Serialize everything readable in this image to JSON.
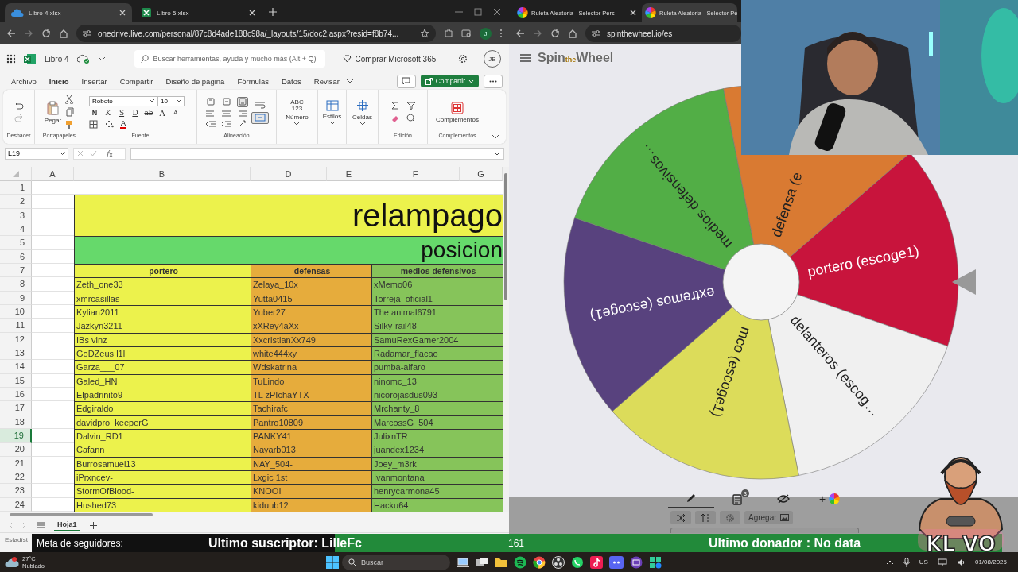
{
  "left_browser": {
    "tabs": [
      {
        "title": "Libro 4.xlsx",
        "kind": "onedrive",
        "selected": true
      },
      {
        "title": "Libro 5.xlsx",
        "kind": "excel",
        "selected": false
      }
    ],
    "url": "onedrive.live.com/personal/87c8d4ade188c98a/_layouts/15/doc2.aspx?resid=f8b74...",
    "profile": "J"
  },
  "excel": {
    "file": "Libro 4",
    "search": {
      "placeholder": "Buscar herramientas, ayuda y mucho más (Alt + Q)"
    },
    "buy": "Comprar Microsoft 365",
    "avatar": "JB",
    "menu": [
      {
        "label": "Archivo",
        "selected": false
      },
      {
        "label": "Inicio",
        "selected": true
      },
      {
        "label": "Insertar",
        "selected": false
      },
      {
        "label": "Compartir",
        "selected": false
      },
      {
        "label": "Diseño de página",
        "selected": false
      },
      {
        "label": "Fórmulas",
        "selected": false
      },
      {
        "label": "Datos",
        "selected": false
      },
      {
        "label": "Revisar",
        "selected": false
      }
    ],
    "share": "Compartir",
    "ribbon": {
      "undo_group": "Deshacer",
      "paste": "Pegar",
      "clipboard_group": "Portapapeles",
      "font": "Roboto",
      "size": "10",
      "font_buttons": [
        {
          "text": "N",
          "kind": "bold"
        },
        {
          "text": "K",
          "kind": "italic"
        },
        {
          "text": "S",
          "kind": "underline"
        },
        {
          "text": "D",
          "kind": "double"
        },
        {
          "text": "ab",
          "kind": "strike"
        },
        {
          "text": "A",
          "kind": "grow"
        },
        {
          "text": "A",
          "kind": "shrink"
        }
      ],
      "font_color_letter": "A",
      "font_group": "Fuente",
      "vertical_align": [
        {
          "selected": false
        },
        {
          "selected": false
        },
        {
          "selected": true
        }
      ],
      "merge_selected": true,
      "align_group": "Alineación",
      "number_glyph": [
        "ABC",
        "123"
      ],
      "number": "Número",
      "styles": "Estilos",
      "cells": "Celdas",
      "edit_group": "Edición",
      "addins": "Complementos",
      "addins_group": "Complementos"
    },
    "name_box": "L19",
    "sheet": {
      "columns": [
        "A",
        "B",
        "D",
        "E",
        "F",
        "G"
      ],
      "rows": [
        {
          "label": "1",
          "selected": false
        },
        {
          "label": "2",
          "selected": false
        },
        {
          "label": "3",
          "selected": false
        },
        {
          "label": "4",
          "selected": false
        },
        {
          "label": "5",
          "selected": false
        },
        {
          "label": "6",
          "selected": false
        },
        {
          "label": "7",
          "selected": false
        },
        {
          "label": "8",
          "selected": false
        },
        {
          "label": "9",
          "selected": false
        },
        {
          "label": "10",
          "selected": false
        },
        {
          "label": "11",
          "selected": false
        },
        {
          "label": "12",
          "selected": false
        },
        {
          "label": "13",
          "selected": false
        },
        {
          "label": "14",
          "selected": false
        },
        {
          "label": "15",
          "selected": false
        },
        {
          "label": "16",
          "selected": false
        },
        {
          "label": "17",
          "selected": false
        },
        {
          "label": "18",
          "selected": false
        },
        {
          "label": "19",
          "selected": true
        },
        {
          "label": "20",
          "selected": false
        },
        {
          "label": "21",
          "selected": false
        },
        {
          "label": "22",
          "selected": false
        },
        {
          "label": "23",
          "selected": false
        },
        {
          "label": "24",
          "selected": false
        }
      ],
      "title": {
        "text": "relampago",
        "color": "#ecf24c"
      },
      "subtitle": {
        "text": "posicion",
        "color": "#66d96b"
      },
      "groups": [
        {
          "header": "portero",
          "color": "#ecf24c",
          "names": [
            "Zeth_one33",
            "xmrcasillas",
            "Kylian2011",
            "Jazkyn3211",
            "IBs vinz",
            "GoDZeus l1l",
            "Garza___07",
            "Galed_HN",
            "Elpadrinito9",
            "Edgiraldo",
            "davidpro_keeperG",
            "Dalvin_RD1",
            "Cafann_",
            "Burrosamuel13",
            "iPrxncev-",
            "StormOfBlood-",
            "Hushed73"
          ]
        },
        {
          "header": "defensas",
          "color": "#e6ac3c",
          "names": [
            "Zelaya_10x",
            "Yutta0415",
            "Yuber27",
            "xXRey4aXx",
            "XxcristianXx749",
            "white444xy",
            "Wdskatrina",
            "TuLindo",
            "TL zPIchaYTX",
            "Tachirafc",
            "Pantro10809",
            "PANKY41",
            "Nayarb013",
            "NAY_504-",
            "Lxgic 1st",
            "KNOOI",
            "kiduub12"
          ]
        },
        {
          "header": "medios defensivos",
          "color": "#86c45a",
          "names": [
            "xMemo06",
            "Torreja_oficial1",
            "The animal6791",
            "Silky-rail48",
            "SamuRexGamer2004",
            "Radamar_flacao",
            "pumba-alfaro",
            "ninomc_13",
            "nicorojasdus093",
            "Mrchanty_8",
            "MarcossG_504",
            "JulixnTR",
            "juandex1234",
            "Joey_m3rk",
            "Ivanmontana",
            "henrycarmona45",
            "Hacku64"
          ]
        }
      ]
    },
    "sheet_tabs": [
      {
        "label": "Hoja1",
        "selected": true
      }
    ],
    "status": "Estadíst"
  },
  "right_browser": {
    "tabs": [
      {
        "title": "Ruleta Aleatoria - Selector Pers",
        "kind": "wheel",
        "selected": false
      },
      {
        "title": "Ruleta Aleatoria - Selector Pe",
        "kind": "wheel",
        "selected": true
      }
    ],
    "url": "spinthewheel.io/es"
  },
  "spin_wheel": {
    "logo": {
      "first": "Spin",
      "middle": "the",
      "last": "Wheel"
    },
    "slices": [
      {
        "label": "portero (escoge1)",
        "color": "#c8143c"
      },
      {
        "label": "delanteros (escog…",
        "color": "#f0f0f0"
      },
      {
        "label": "mco (escoge1)",
        "color": "#dcdc5a"
      },
      {
        "label": "extremos (escoge1)",
        "color": "#58427e"
      },
      {
        "label": "medios defensivos…",
        "color": "#52ae46"
      },
      {
        "label": "defensa (e",
        "color": "#d97a32"
      }
    ],
    "tools": [
      {
        "kind": "edit",
        "selected": true
      },
      {
        "kind": "list",
        "selected": false,
        "badge": "3"
      },
      {
        "kind": "hide",
        "selected": false
      },
      {
        "kind": "color",
        "selected": false,
        "label": "+"
      }
    ],
    "buttons": [
      {
        "kind": "shuffle"
      },
      {
        "kind": "sort"
      },
      {
        "kind": "settings"
      },
      {
        "kind": "add_image",
        "label": "Agregar"
      }
    ]
  },
  "stream_overlay": {
    "followers_goal": "Meta de seguidores:",
    "last_sub": "Ultimo suscriptor: LilleFc",
    "count": "161",
    "last_donor": "Ultimo donador : No data",
    "logo_text": "KL VO"
  },
  "taskbar": {
    "weather": {
      "temp": "27°C",
      "condition": "Nublado"
    },
    "search": {
      "placeholder": "Buscar"
    },
    "language": "US",
    "date": "01/08/2025"
  }
}
